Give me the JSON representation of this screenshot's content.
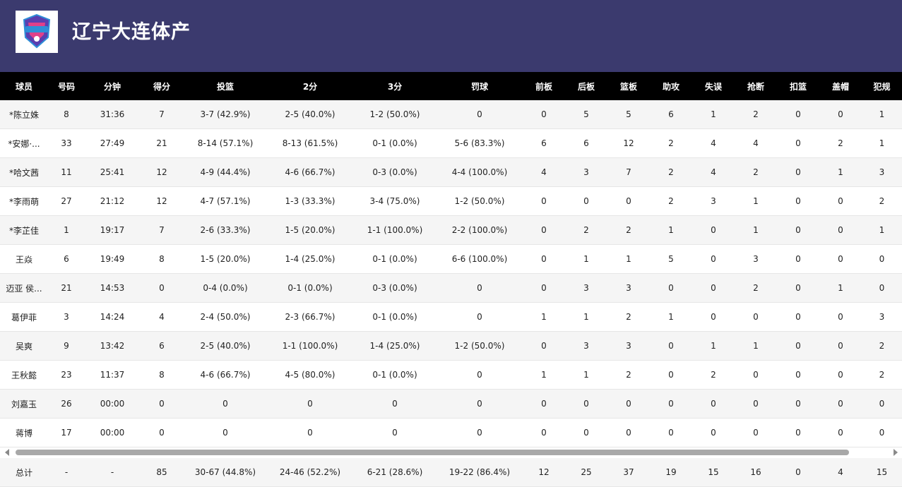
{
  "team": {
    "name": "辽宁大连体产",
    "logo_icon": "team-logo-icon",
    "colors": {
      "header": "#3b3a6e",
      "table_header": "#000000"
    }
  },
  "columns": [
    "球员",
    "号码",
    "分钟",
    "得分",
    "投篮",
    "2分",
    "3分",
    "罚球",
    "前板",
    "后板",
    "篮板",
    "助攻",
    "失误",
    "抢断",
    "扣篮",
    "盖帽",
    "犯规"
  ],
  "players": [
    [
      "*陈立姝",
      "8",
      "31:36",
      "7",
      "3-7 (42.9%)",
      "2-5 (40.0%)",
      "1-2 (50.0%)",
      "0",
      "0",
      "5",
      "5",
      "6",
      "1",
      "2",
      "0",
      "0",
      "1"
    ],
    [
      "*安娜·...",
      "33",
      "27:49",
      "21",
      "8-14 (57.1%)",
      "8-13 (61.5%)",
      "0-1 (0.0%)",
      "5-6 (83.3%)",
      "6",
      "6",
      "12",
      "2",
      "4",
      "4",
      "0",
      "2",
      "1"
    ],
    [
      "*哈文茜",
      "11",
      "25:41",
      "12",
      "4-9 (44.4%)",
      "4-6 (66.7%)",
      "0-3 (0.0%)",
      "4-4 (100.0%)",
      "4",
      "3",
      "7",
      "2",
      "4",
      "2",
      "0",
      "1",
      "3"
    ],
    [
      "*李雨萌",
      "27",
      "21:12",
      "12",
      "4-7 (57.1%)",
      "1-3 (33.3%)",
      "3-4 (75.0%)",
      "1-2 (50.0%)",
      "0",
      "0",
      "0",
      "2",
      "3",
      "1",
      "0",
      "0",
      "2"
    ],
    [
      "*李芷佳",
      "1",
      "19:17",
      "7",
      "2-6 (33.3%)",
      "1-5 (20.0%)",
      "1-1 (100.0%)",
      "2-2 (100.0%)",
      "0",
      "2",
      "2",
      "1",
      "0",
      "1",
      "0",
      "0",
      "1"
    ],
    [
      "王焱",
      "6",
      "19:49",
      "8",
      "1-5 (20.0%)",
      "1-4 (25.0%)",
      "0-1 (0.0%)",
      "6-6 (100.0%)",
      "0",
      "1",
      "1",
      "5",
      "0",
      "3",
      "0",
      "0",
      "0"
    ],
    [
      "迈亚 侯...",
      "21",
      "14:53",
      "0",
      "0-4 (0.0%)",
      "0-1 (0.0%)",
      "0-3 (0.0%)",
      "0",
      "0",
      "3",
      "3",
      "0",
      "0",
      "2",
      "0",
      "1",
      "0"
    ],
    [
      "葛伊菲",
      "3",
      "14:24",
      "4",
      "2-4 (50.0%)",
      "2-3 (66.7%)",
      "0-1 (0.0%)",
      "0",
      "1",
      "1",
      "2",
      "1",
      "0",
      "0",
      "0",
      "0",
      "3"
    ],
    [
      "吴爽",
      "9",
      "13:42",
      "6",
      "2-5 (40.0%)",
      "1-1 (100.0%)",
      "1-4 (25.0%)",
      "1-2 (50.0%)",
      "0",
      "3",
      "3",
      "0",
      "1",
      "1",
      "0",
      "0",
      "2"
    ],
    [
      "王秋懿",
      "23",
      "11:37",
      "8",
      "4-6 (66.7%)",
      "4-5 (80.0%)",
      "0-1 (0.0%)",
      "0",
      "1",
      "1",
      "2",
      "0",
      "2",
      "0",
      "0",
      "0",
      "2"
    ],
    [
      "刘嘉玉",
      "26",
      "00:00",
      "0",
      "0",
      "0",
      "0",
      "0",
      "0",
      "0",
      "0",
      "0",
      "0",
      "0",
      "0",
      "0",
      "0"
    ],
    [
      "蒋博",
      "17",
      "00:00",
      "0",
      "0",
      "0",
      "0",
      "0",
      "0",
      "0",
      "0",
      "0",
      "0",
      "0",
      "0",
      "0",
      "0"
    ]
  ],
  "totals": [
    "总计",
    "-",
    "-",
    "85",
    "30-67 (44.8%)",
    "24-46 (52.2%)",
    "6-21 (28.6%)",
    "19-22 (86.4%)",
    "12",
    "25",
    "37",
    "19",
    "15",
    "16",
    "0",
    "4",
    "15"
  ],
  "scrollbar": {
    "left_icon": "scroll-left-arrow-icon",
    "right_icon": "scroll-right-arrow-icon"
  }
}
